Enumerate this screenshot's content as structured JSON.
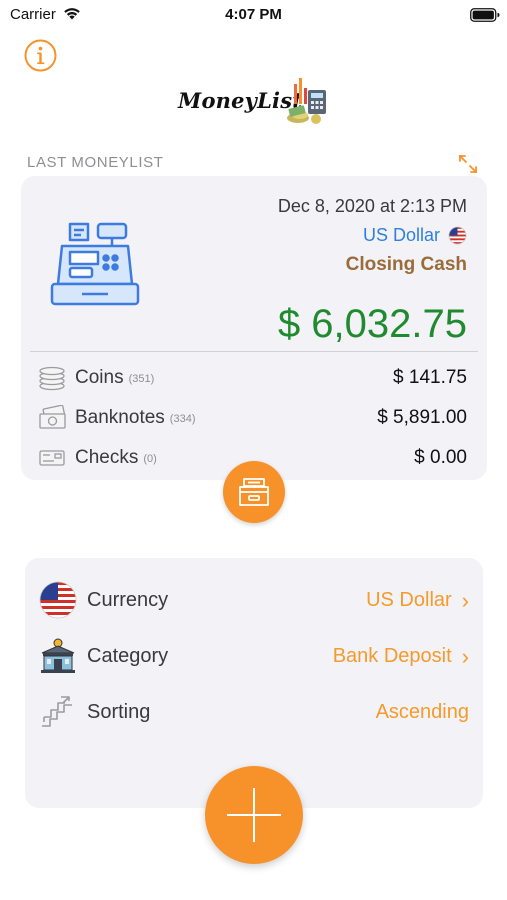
{
  "status_bar": {
    "carrier": "Carrier",
    "time": "4:07 PM"
  },
  "header": {
    "logo_text": "MoneyList",
    "info_icon": "info-circle-icon"
  },
  "last_moneylist": {
    "section_label": "LAST MONEYLIST",
    "expand_icon": "expand-arrows-icon",
    "date": "Dec 8, 2020 at 2:13 PM",
    "currency": "US Dollar",
    "category": "Closing Cash",
    "total": "$ 6,032.75",
    "breakdown": [
      {
        "name": "Coins",
        "count": "(351)",
        "value": "$ 141.75",
        "icon": "coins-icon"
      },
      {
        "name": "Banknotes",
        "count": "(334)",
        "value": "$ 5,891.00",
        "icon": "banknote-icon"
      },
      {
        "name": "Checks",
        "count": "(0)",
        "value": "$ 0.00",
        "icon": "check-icon"
      }
    ]
  },
  "settings": [
    {
      "label": "Currency",
      "value": "US Dollar",
      "icon": "us-flag-icon",
      "has_chevron": true
    },
    {
      "label": "Category",
      "value": "Bank Deposit",
      "icon": "bank-building-icon",
      "has_chevron": true
    },
    {
      "label": "Sorting",
      "value": "Ascending",
      "icon": "stairs-icon",
      "has_chevron": false
    }
  ],
  "colors": {
    "accent": "#f7922a",
    "total_green": "#1f8a2e",
    "link_blue": "#2f7fe0",
    "closing_brown": "#9a6b3b",
    "card_bg": "#f2f2f7"
  }
}
